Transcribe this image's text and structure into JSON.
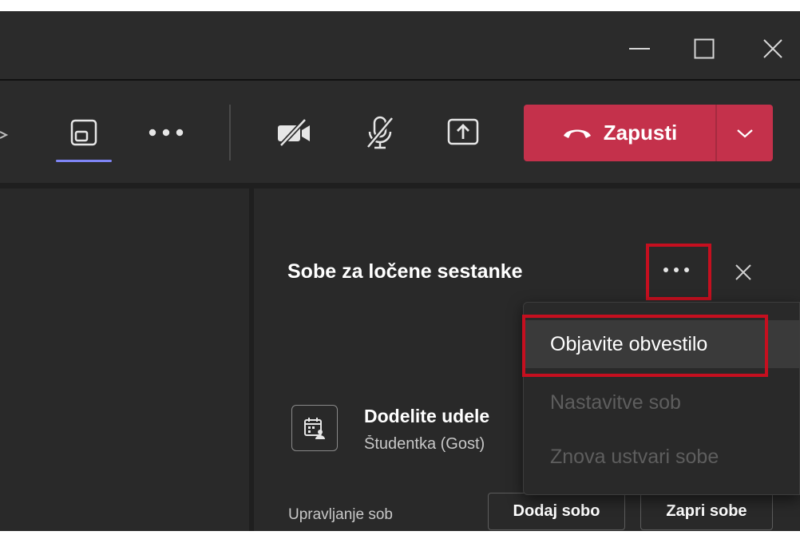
{
  "window_controls": {
    "minimize_icon": "minimize-icon",
    "maximize_icon": "maximize-icon",
    "close_icon": "close-icon"
  },
  "toolbar": {
    "icons": [
      "view-icon",
      "more-icon",
      "camera-off-icon",
      "mic-off-icon",
      "share-screen-icon"
    ],
    "leave_label": "Zapusti",
    "leave_icon": "phone-hangup-icon",
    "dropdown_icon": "chevron-down-icon",
    "leave_color": "#c4314b",
    "active_indicator_color": "#7f85f5"
  },
  "panel": {
    "title": "Sobe za ločene sestanke",
    "more_icon": "more-icon",
    "close_icon": "close-icon",
    "assign": {
      "icon": "calendar-assign-icon",
      "title": "Dodelite udele",
      "subtitle": "Študentka (Gost)"
    },
    "manage_label": "Upravljanje sob",
    "add_room_label": "Dodaj sobo",
    "close_rooms_label": "Zapri sobe"
  },
  "context_menu": {
    "items": [
      {
        "label": "Objavite obvestilo",
        "enabled": true
      },
      {
        "label": "Nastavitve sob",
        "enabled": false
      },
      {
        "label": "Znova ustvari sobe",
        "enabled": false
      }
    ]
  },
  "highlight_color": "#c50f1f"
}
